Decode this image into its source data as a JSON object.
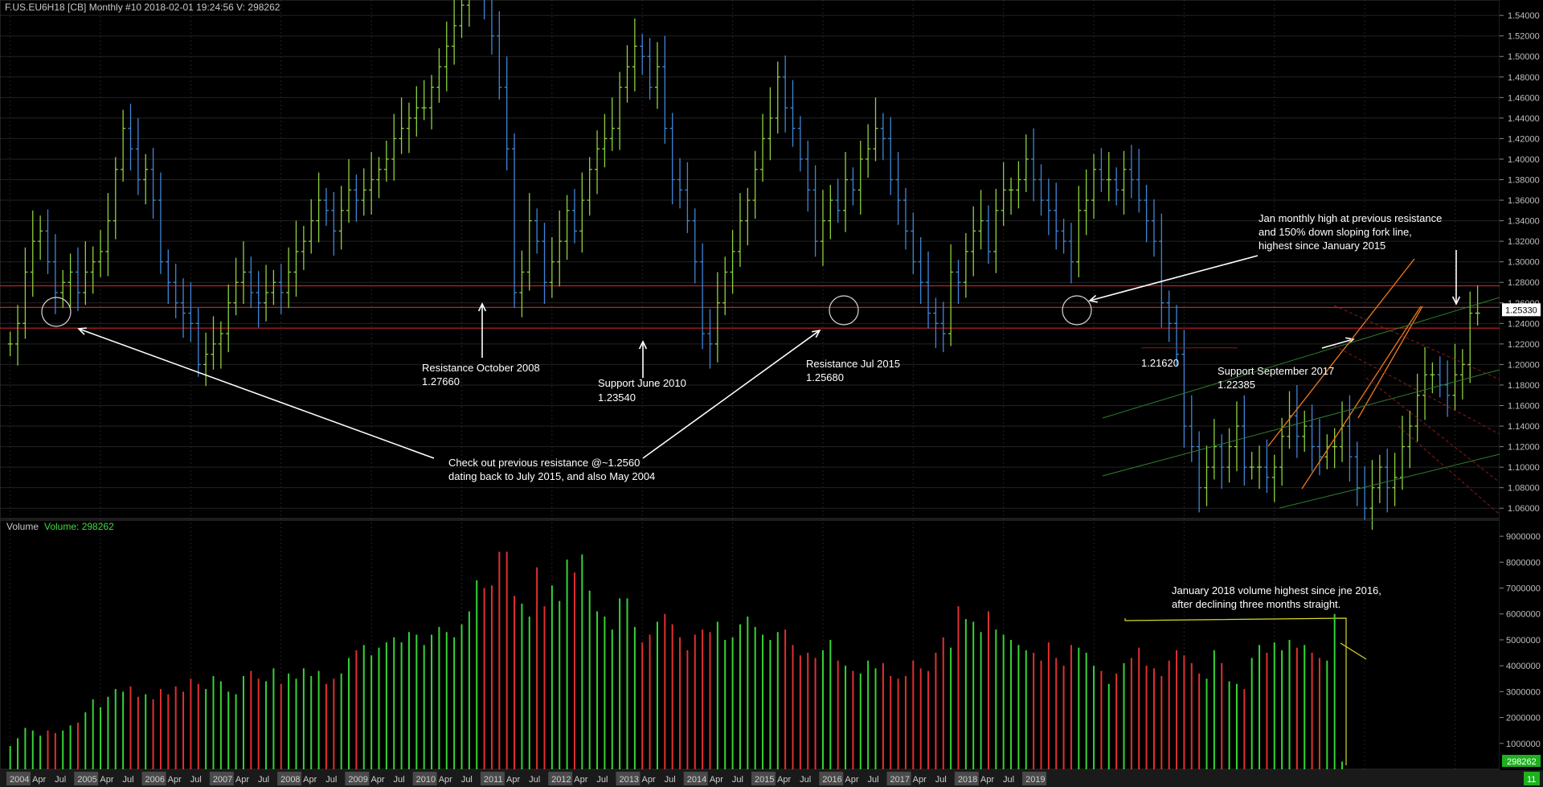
{
  "header": {
    "symbol_line": "F.US.EU6H18 [CB]  Monthly  #10 2018-02-01 19:24:56 V: 298262"
  },
  "price_axis": {
    "ticks": [
      "1.54000",
      "1.52000",
      "1.50000",
      "1.48000",
      "1.46000",
      "1.44000",
      "1.42000",
      "1.40000",
      "1.38000",
      "1.36000",
      "1.34000",
      "1.32000",
      "1.30000",
      "1.28000",
      "1.26000",
      "1.24000",
      "1.22000",
      "1.20000",
      "1.18000",
      "1.16000",
      "1.14000",
      "1.12000",
      "1.10000",
      "1.08000",
      "1.06000"
    ],
    "last_price": "1.25330"
  },
  "volume_panel": {
    "title": "Volume",
    "value_label": "Volume: 298262",
    "ticks": [
      "9000000",
      "8000000",
      "7000000",
      "6000000",
      "5000000",
      "4000000",
      "3000000",
      "2000000",
      "1000000"
    ],
    "last_volume": "298262"
  },
  "time_axis": {
    "labels": [
      {
        "t": "2004",
        "y": true
      },
      {
        "t": "Apr"
      },
      {
        "t": "Jul"
      },
      {
        "t": "2005",
        "y": true
      },
      {
        "t": "Apr"
      },
      {
        "t": "Jul"
      },
      {
        "t": "2006",
        "y": true
      },
      {
        "t": "Apr"
      },
      {
        "t": "Jul"
      },
      {
        "t": "2007",
        "y": true
      },
      {
        "t": "Apr"
      },
      {
        "t": "Jul"
      },
      {
        "t": "2008",
        "y": true
      },
      {
        "t": "Apr"
      },
      {
        "t": "Jul"
      },
      {
        "t": "2009",
        "y": true
      },
      {
        "t": "Apr"
      },
      {
        "t": "Jul"
      },
      {
        "t": "2010",
        "y": true
      },
      {
        "t": "Apr"
      },
      {
        "t": "Jul"
      },
      {
        "t": "2011",
        "y": true
      },
      {
        "t": "Apr"
      },
      {
        "t": "Jul"
      },
      {
        "t": "2012",
        "y": true
      },
      {
        "t": "Apr"
      },
      {
        "t": "Jul"
      },
      {
        "t": "2013",
        "y": true
      },
      {
        "t": "Apr"
      },
      {
        "t": "Jul"
      },
      {
        "t": "2014",
        "y": true
      },
      {
        "t": "Apr"
      },
      {
        "t": "Jul"
      },
      {
        "t": "2015",
        "y": true
      },
      {
        "t": "Apr"
      },
      {
        "t": "Jul"
      },
      {
        "t": "2016",
        "y": true
      },
      {
        "t": "Apr"
      },
      {
        "t": "Jul"
      },
      {
        "t": "2017",
        "y": true
      },
      {
        "t": "Apr"
      },
      {
        "t": "Jul"
      },
      {
        "t": "2018",
        "y": true
      },
      {
        "t": "Apr"
      },
      {
        "t": "Jul"
      },
      {
        "t": "2019",
        "y": true
      }
    ],
    "end_marker": "11"
  },
  "annotations": {
    "resistance_2008": [
      "Resistance October 2008",
      "1.27660"
    ],
    "support_2010": [
      "Support June 2010",
      "1.23540"
    ],
    "resistance_2015": [
      "Resistance Jul 2015",
      "1.25680"
    ],
    "check_out": [
      "Check out previous resistance @~1.2560",
      "dating back to July 2015, and also May 2004"
    ],
    "jan_high": [
      "Jan monthly high at previous resistance",
      "and 150% down sloping fork line,",
      "highest since January 2015"
    ],
    "label_12162": [
      "1.21620"
    ],
    "support_2017": [
      "Support September 2017",
      "1.22385"
    ],
    "volume_note": [
      "January 2018 volume highest since jne 2016,",
      "after declining three months straight."
    ]
  },
  "colors": {
    "bar_up": "#8fd13f",
    "bar_down": "#3f86d9",
    "vol_up": "#35d435",
    "vol_down": "#e03030",
    "resistance_line": "#c42424",
    "grid": "#232323",
    "axis_bg_last": "#ffffff",
    "volume_label_bg": "#1eb01e"
  },
  "chart_data": {
    "type": "ohlc-monthly",
    "instrument": "F.US.EU6H18",
    "period": "Monthly",
    "price_range": [
      1.05,
      1.555
    ],
    "volume_range": [
      0,
      9500000
    ],
    "horizontal_levels": [
      1.2766,
      1.2556,
      1.2354
    ],
    "closes": [
      1.22,
      1.24,
      1.29,
      1.32,
      1.33,
      1.3,
      1.27,
      1.28,
      1.29,
      1.27,
      1.29,
      1.3,
      1.31,
      1.34,
      1.39,
      1.43,
      1.41,
      1.38,
      1.39,
      1.36,
      1.3,
      1.28,
      1.26,
      1.25,
      1.24,
      1.2,
      1.21,
      1.22,
      1.23,
      1.26,
      1.28,
      1.29,
      1.27,
      1.26,
      1.27,
      1.28,
      1.27,
      1.29,
      1.31,
      1.32,
      1.34,
      1.36,
      1.35,
      1.33,
      1.35,
      1.37,
      1.36,
      1.37,
      1.38,
      1.39,
      1.4,
      1.42,
      1.43,
      1.44,
      1.45,
      1.45,
      1.47,
      1.49,
      1.51,
      1.53,
      1.55,
      1.57,
      1.58,
      1.56,
      1.52,
      1.47,
      1.41,
      1.27,
      1.29,
      1.34,
      1.32,
      1.28,
      1.3,
      1.32,
      1.35,
      1.33,
      1.36,
      1.39,
      1.41,
      1.42,
      1.43,
      1.47,
      1.49,
      1.51,
      1.5,
      1.47,
      1.49,
      1.43,
      1.38,
      1.37,
      1.34,
      1.3,
      1.23,
      1.22,
      1.26,
      1.29,
      1.31,
      1.34,
      1.36,
      1.39,
      1.42,
      1.44,
      1.48,
      1.45,
      1.43,
      1.4,
      1.37,
      1.32,
      1.34,
      1.36,
      1.35,
      1.38,
      1.37,
      1.4,
      1.41,
      1.43,
      1.42,
      1.38,
      1.36,
      1.33,
      1.3,
      1.28,
      1.25,
      1.24,
      1.23,
      1.29,
      1.28,
      1.31,
      1.33,
      1.34,
      1.31,
      1.35,
      1.37,
      1.37,
      1.38,
      1.4,
      1.38,
      1.36,
      1.35,
      1.33,
      1.32,
      1.3,
      1.35,
      1.36,
      1.39,
      1.38,
      1.38,
      1.37,
      1.39,
      1.38,
      1.36,
      1.34,
      1.32,
      1.26,
      1.24,
      1.21,
      1.14,
      1.12,
      1.08,
      1.1,
      1.12,
      1.1,
      1.12,
      1.14,
      1.1,
      1.1,
      1.1,
      1.09,
      1.1,
      1.13,
      1.15,
      1.13,
      1.14,
      1.12,
      1.11,
      1.12,
      1.12,
      1.14,
      1.11,
      1.08,
      1.06,
      1.08,
      1.1,
      1.08,
      1.09,
      1.12,
      1.14,
      1.17,
      1.19,
      1.19,
      1.18,
      1.17,
      1.19,
      1.2,
      1.25,
      1.25
    ],
    "volumes_millions": [
      0.9,
      1.2,
      1.6,
      1.5,
      1.3,
      1.5,
      1.4,
      1.5,
      1.7,
      1.8,
      2.2,
      2.7,
      2.4,
      2.8,
      3.1,
      3.0,
      3.2,
      2.8,
      2.9,
      2.7,
      3.1,
      2.9,
      3.2,
      3.0,
      3.5,
      3.3,
      3.1,
      3.6,
      3.4,
      3.0,
      2.9,
      3.6,
      3.8,
      3.5,
      3.4,
      3.9,
      3.3,
      3.7,
      3.5,
      3.9,
      3.6,
      3.8,
      3.3,
      3.5,
      3.7,
      4.3,
      4.6,
      4.8,
      4.4,
      4.7,
      4.9,
      5.1,
      4.9,
      5.3,
      5.2,
      4.8,
      5.2,
      5.5,
      5.3,
      5.1,
      5.6,
      6.1,
      7.3,
      7.0,
      7.1,
      8.4,
      8.4,
      6.7,
      6.4,
      5.9,
      7.8,
      6.3,
      7.1,
      6.5,
      8.1,
      7.6,
      8.3,
      6.9,
      6.1,
      5.9,
      5.4,
      6.6,
      6.6,
      5.5,
      4.9,
      5.2,
      5.7,
      6.0,
      5.6,
      5.1,
      4.6,
      5.2,
      5.4,
      5.3,
      5.7,
      5.0,
      5.1,
      5.6,
      5.9,
      5.5,
      5.2,
      5.0,
      5.3,
      5.4,
      4.8,
      4.4,
      4.5,
      4.3,
      4.6,
      5.0,
      4.2,
      4.0,
      3.8,
      3.7,
      4.2,
      3.9,
      4.1,
      3.6,
      3.5,
      3.6,
      4.2,
      3.9,
      3.8,
      4.5,
      5.1,
      4.7,
      6.3,
      5.8,
      5.7,
      5.3,
      6.1,
      5.4,
      5.2,
      5.0,
      4.8,
      4.6,
      4.5,
      4.2,
      4.9,
      4.3,
      4.0,
      4.8,
      4.7,
      4.5,
      4.0,
      3.8,
      3.3,
      3.7,
      4.1,
      4.3,
      4.7,
      4.0,
      3.9,
      3.6,
      4.2,
      4.6,
      4.4,
      4.1,
      3.7,
      3.5,
      4.6,
      4.1,
      3.4,
      3.3,
      3.1,
      4.3,
      4.8,
      4.5,
      4.9,
      4.6,
      5.0,
      4.7,
      4.8,
      4.5,
      4.3,
      4.2,
      6.0,
      0.3
    ],
    "up_months_mask": "alternating-by-close"
  }
}
